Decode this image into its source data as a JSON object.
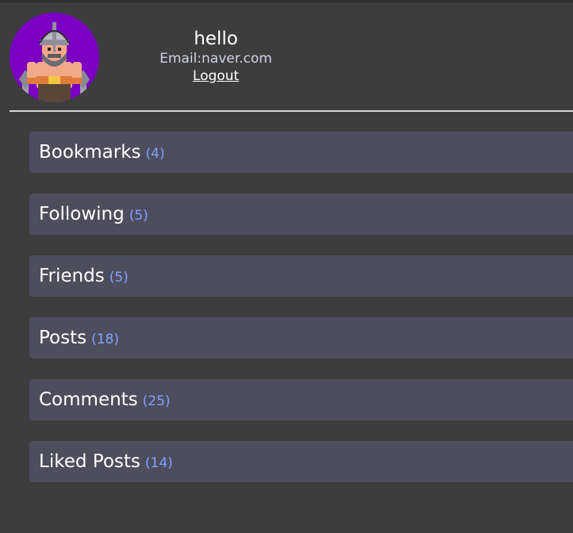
{
  "profile": {
    "username": "hello",
    "email_label": "Email:",
    "email": "naver.com",
    "logout_label": "Logout"
  },
  "sections": [
    {
      "label": "Bookmarks",
      "count": "(4)"
    },
    {
      "label": "Following",
      "count": "(5)"
    },
    {
      "label": "Friends",
      "count": "(5)"
    },
    {
      "label": "Posts",
      "count": "(18)"
    },
    {
      "label": "Comments",
      "count": "(25)"
    },
    {
      "label": "Liked Posts",
      "count": "(14)"
    }
  ],
  "colors": {
    "background": "#3d3d3d",
    "section_bg": "#4e4d5e",
    "count": "#7da4ff",
    "avatar_bg": "#7b00c4"
  },
  "icons": {
    "avatar": "viking-warrior-avatar"
  }
}
